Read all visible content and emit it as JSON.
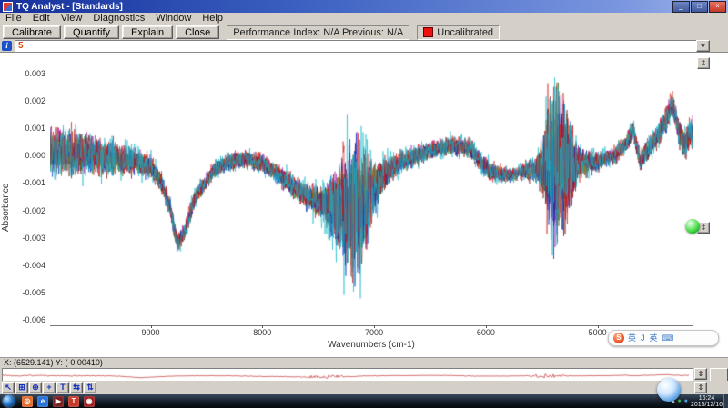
{
  "titlebar": {
    "title": "TQ Analyst - [Standards]",
    "min": "_",
    "max": "□",
    "close": "×"
  },
  "menubar": {
    "items": [
      "File",
      "Edit",
      "View",
      "Diagnostics",
      "Window",
      "Help"
    ]
  },
  "toolbar": {
    "buttons": [
      "Calibrate",
      "Quantify",
      "Explain",
      "Close"
    ],
    "performance": "Performance Index:  N/A  Previous:  N/A",
    "calibration_status": "Uncalibrated",
    "status_color": "#ee1111"
  },
  "selector": {
    "info": "i",
    "value": "5",
    "dropdown": "▼",
    "updown": "⇕"
  },
  "chart_data": {
    "type": "line",
    "title": "",
    "xlabel": "Wavenumbers (cm-1)",
    "ylabel": "Absorbance",
    "xlim": [
      9900,
      4150
    ],
    "ylim": [
      -0.0062,
      0.0035
    ],
    "x_ticks": [
      "9000",
      "8000",
      "7000",
      "6000",
      "5000"
    ],
    "y_ticks": [
      "0.003",
      "0.002",
      "0.001",
      "0.000",
      "-0.001",
      "-0.002",
      "-0.003",
      "-0.004",
      "-0.005",
      "-0.006"
    ],
    "grid": false,
    "legend": "none",
    "description": "Overlaid noisy NIR spectra of multiple standards; broad dip near 8750 to -0.0035, noisy spike cluster 7350-7050 reaching -0.0055, hump near 6400, dense spike cluster 5480-5180 spanning -0.005 to +0.0033, sharp peaks near 4680 and 4330",
    "series": [
      {
        "name": "spectrum-black",
        "color": "#202020",
        "seed": 101,
        "amp": 0.75,
        "offset": 4e-05
      },
      {
        "name": "spectrum-green",
        "color": "#1a7a1a",
        "seed": 202,
        "amp": 0.9,
        "offset": -5e-05
      },
      {
        "name": "spectrum-magenta",
        "color": "#b020b0",
        "seed": 303,
        "amp": 0.92,
        "offset": 6e-05
      },
      {
        "name": "spectrum-darkred",
        "color": "#7a1010",
        "seed": 404,
        "amp": 1.0,
        "offset": -8e-05
      },
      {
        "name": "spectrum-olive",
        "color": "#8a7a10",
        "seed": 505,
        "amp": 0.85,
        "offset": 2e-05
      },
      {
        "name": "spectrum-blue",
        "color": "#1030c0",
        "seed": 606,
        "amp": 1.05,
        "offset": -3e-05
      },
      {
        "name": "spectrum-red",
        "color": "#d01818",
        "seed": 707,
        "amp": 1.15,
        "offset": 5e-05
      },
      {
        "name": "spectrum-cyan",
        "color": "#10b8c8",
        "seed": 808,
        "amp": 1.35,
        "offset": 0
      }
    ],
    "baseline_profile": [
      [
        9900,
        0.0002
      ],
      [
        9500,
        0.0
      ],
      [
        9150,
        -0.0002
      ],
      [
        9000,
        -0.0004
      ],
      [
        8900,
        -0.001
      ],
      [
        8820,
        -0.002
      ],
      [
        8760,
        -0.0032
      ],
      [
        8700,
        -0.0028
      ],
      [
        8600,
        -0.0015
      ],
      [
        8450,
        -0.0006
      ],
      [
        8300,
        -0.0002
      ],
      [
        8150,
        -0.0001
      ],
      [
        8000,
        -0.0003
      ],
      [
        7850,
        -0.0007
      ],
      [
        7700,
        -0.0012
      ],
      [
        7550,
        -0.0016
      ],
      [
        7400,
        -0.0018
      ],
      [
        7250,
        -0.0019
      ],
      [
        7120,
        -0.0018
      ],
      [
        7000,
        -0.0012
      ],
      [
        6900,
        -0.0006
      ],
      [
        6750,
        -0.0002
      ],
      [
        6500,
        0.0002
      ],
      [
        6300,
        0.0004
      ],
      [
        6150,
        0.0003
      ],
      [
        6050,
        -0.0002
      ],
      [
        5950,
        -0.0006
      ],
      [
        5800,
        -0.0007
      ],
      [
        5650,
        -0.0006
      ],
      [
        5500,
        -0.0004
      ],
      [
        5400,
        -0.0003
      ],
      [
        5300,
        -0.0003
      ],
      [
        5150,
        -0.0003
      ],
      [
        5000,
        -0.0002
      ],
      [
        4850,
        0.0
      ],
      [
        4750,
        0.0004
      ],
      [
        4680,
        0.001
      ],
      [
        4620,
        -0.0002
      ],
      [
        4560,
        0.0002
      ],
      [
        4480,
        0.0006
      ],
      [
        4400,
        0.0012
      ],
      [
        4330,
        0.0019
      ],
      [
        4270,
        0.0008
      ],
      [
        4220,
        0.0004
      ],
      [
        4150,
        0.0009
      ]
    ],
    "noise_profile": [
      [
        9900,
        0.0011
      ],
      [
        9600,
        0.0009
      ],
      [
        9300,
        0.0007
      ],
      [
        9050,
        0.0005
      ],
      [
        8800,
        0.0004
      ],
      [
        8500,
        0.00035
      ],
      [
        8200,
        0.00035
      ],
      [
        7900,
        0.0004
      ],
      [
        7650,
        0.0005
      ],
      [
        7450,
        0.0008
      ],
      [
        7350,
        0.0016
      ],
      [
        7280,
        0.0026
      ],
      [
        7200,
        0.003
      ],
      [
        7120,
        0.0031
      ],
      [
        7050,
        0.0018
      ],
      [
        6950,
        0.0008
      ],
      [
        6800,
        0.0005
      ],
      [
        6500,
        0.00035
      ],
      [
        6200,
        0.0004
      ],
      [
        6000,
        0.00045
      ],
      [
        5850,
        0.0003
      ],
      [
        5700,
        0.00028
      ],
      [
        5550,
        0.0005
      ],
      [
        5480,
        0.0015
      ],
      [
        5430,
        0.0034
      ],
      [
        5380,
        0.0037
      ],
      [
        5320,
        0.0033
      ],
      [
        5260,
        0.0024
      ],
      [
        5180,
        0.0009
      ],
      [
        5080,
        0.0005
      ],
      [
        4900,
        0.00032
      ],
      [
        4700,
        0.0004
      ],
      [
        4550,
        0.00042
      ],
      [
        4400,
        0.0005
      ],
      [
        4280,
        0.00055
      ],
      [
        4150,
        0.0007
      ]
    ]
  },
  "statusbar": {
    "coords": "X: (6529.141) Y: (-0.00410)"
  },
  "overview": {
    "color": "#c03030",
    "updown": "⇕"
  },
  "tools": {
    "updown": "⇕",
    "buttons": [
      {
        "name": "pointer-tool",
        "glyph": "↖"
      },
      {
        "name": "region-select-tool",
        "glyph": "⊞"
      },
      {
        "name": "zoom-tool",
        "glyph": "⊕"
      },
      {
        "name": "crosshair-tool",
        "glyph": "+"
      },
      {
        "name": "text-tool",
        "glyph": "T"
      },
      {
        "name": "hscroll-tool",
        "glyph": "⇆"
      },
      {
        "name": "vscroll-tool",
        "glyph": "⇅"
      }
    ]
  },
  "taskbar": {
    "apps": [
      {
        "name": "browser-360",
        "glyph": "◎",
        "bg": "#e06a2a"
      },
      {
        "name": "ie-browser",
        "glyph": "e",
        "bg": "#2a72d8"
      },
      {
        "name": "media-player",
        "glyph": "▶",
        "bg": "#7c1f1f"
      },
      {
        "name": "tq-analyst",
        "glyph": "T",
        "bg": "#c43a2a"
      },
      {
        "name": "recorder",
        "glyph": "◉",
        "bg": "#a02020"
      }
    ],
    "tray_icons": [
      {
        "name": "notify-up",
        "glyph": "▴",
        "color": "#ffffff"
      },
      {
        "name": "antivirus",
        "glyph": "●",
        "color": "#4caf50"
      },
      {
        "name": "network",
        "glyph": "●",
        "color": "#4aa3e0"
      }
    ],
    "tray_time": "16:24",
    "tray_date": "2015/12/16"
  },
  "floating": {
    "sogou": {
      "logo": "S",
      "items": [
        "英",
        "J",
        "英",
        "⌨"
      ]
    }
  }
}
